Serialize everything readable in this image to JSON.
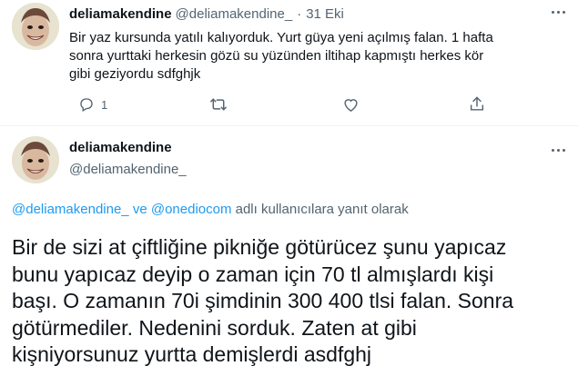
{
  "tweet1": {
    "display_name": "deliamakendine",
    "handle": "@deliamakendine_",
    "separator": "·",
    "date": "31 Eki",
    "text": "Bir yaz kursunda yatılı kalıyorduk. Yurt güya yeni açılmış falan. 1 hafta sonra yurttaki herkesin gözü su yüzünden iltihap kapmıştı herkes kör gibi geziyordu sdfghjk",
    "reply_count": "1"
  },
  "tweet2": {
    "display_name": "deliamakendine",
    "handle": "@deliamakendine_",
    "reply_to": {
      "user1": "@deliamakendine_",
      "joiner": "ve",
      "user2": "@onediocom",
      "suffix": "adlı kullanıcılara yanıt olarak"
    },
    "lines": [
      "Bir de sizi at çiftliğine pikniğe götürücez şunu yapıcaz",
      "bunu yapıcaz deyip o zaman için 70 tl almışlardı kişi",
      "başı. O zamanın 70i şimdinin 300 400 tlsi falan. Sonra",
      "götürmediler. Nedenini sorduk. Zaten at gibi",
      "kişniyorsunuz yurtta demişlerdi asdfghj"
    ]
  },
  "colors": {
    "link": "#1d9bf0",
    "muted": "#536471",
    "text": "#0f1419"
  },
  "icons": [
    "more-icon",
    "reply-icon",
    "retweet-icon",
    "like-icon",
    "share-icon"
  ]
}
